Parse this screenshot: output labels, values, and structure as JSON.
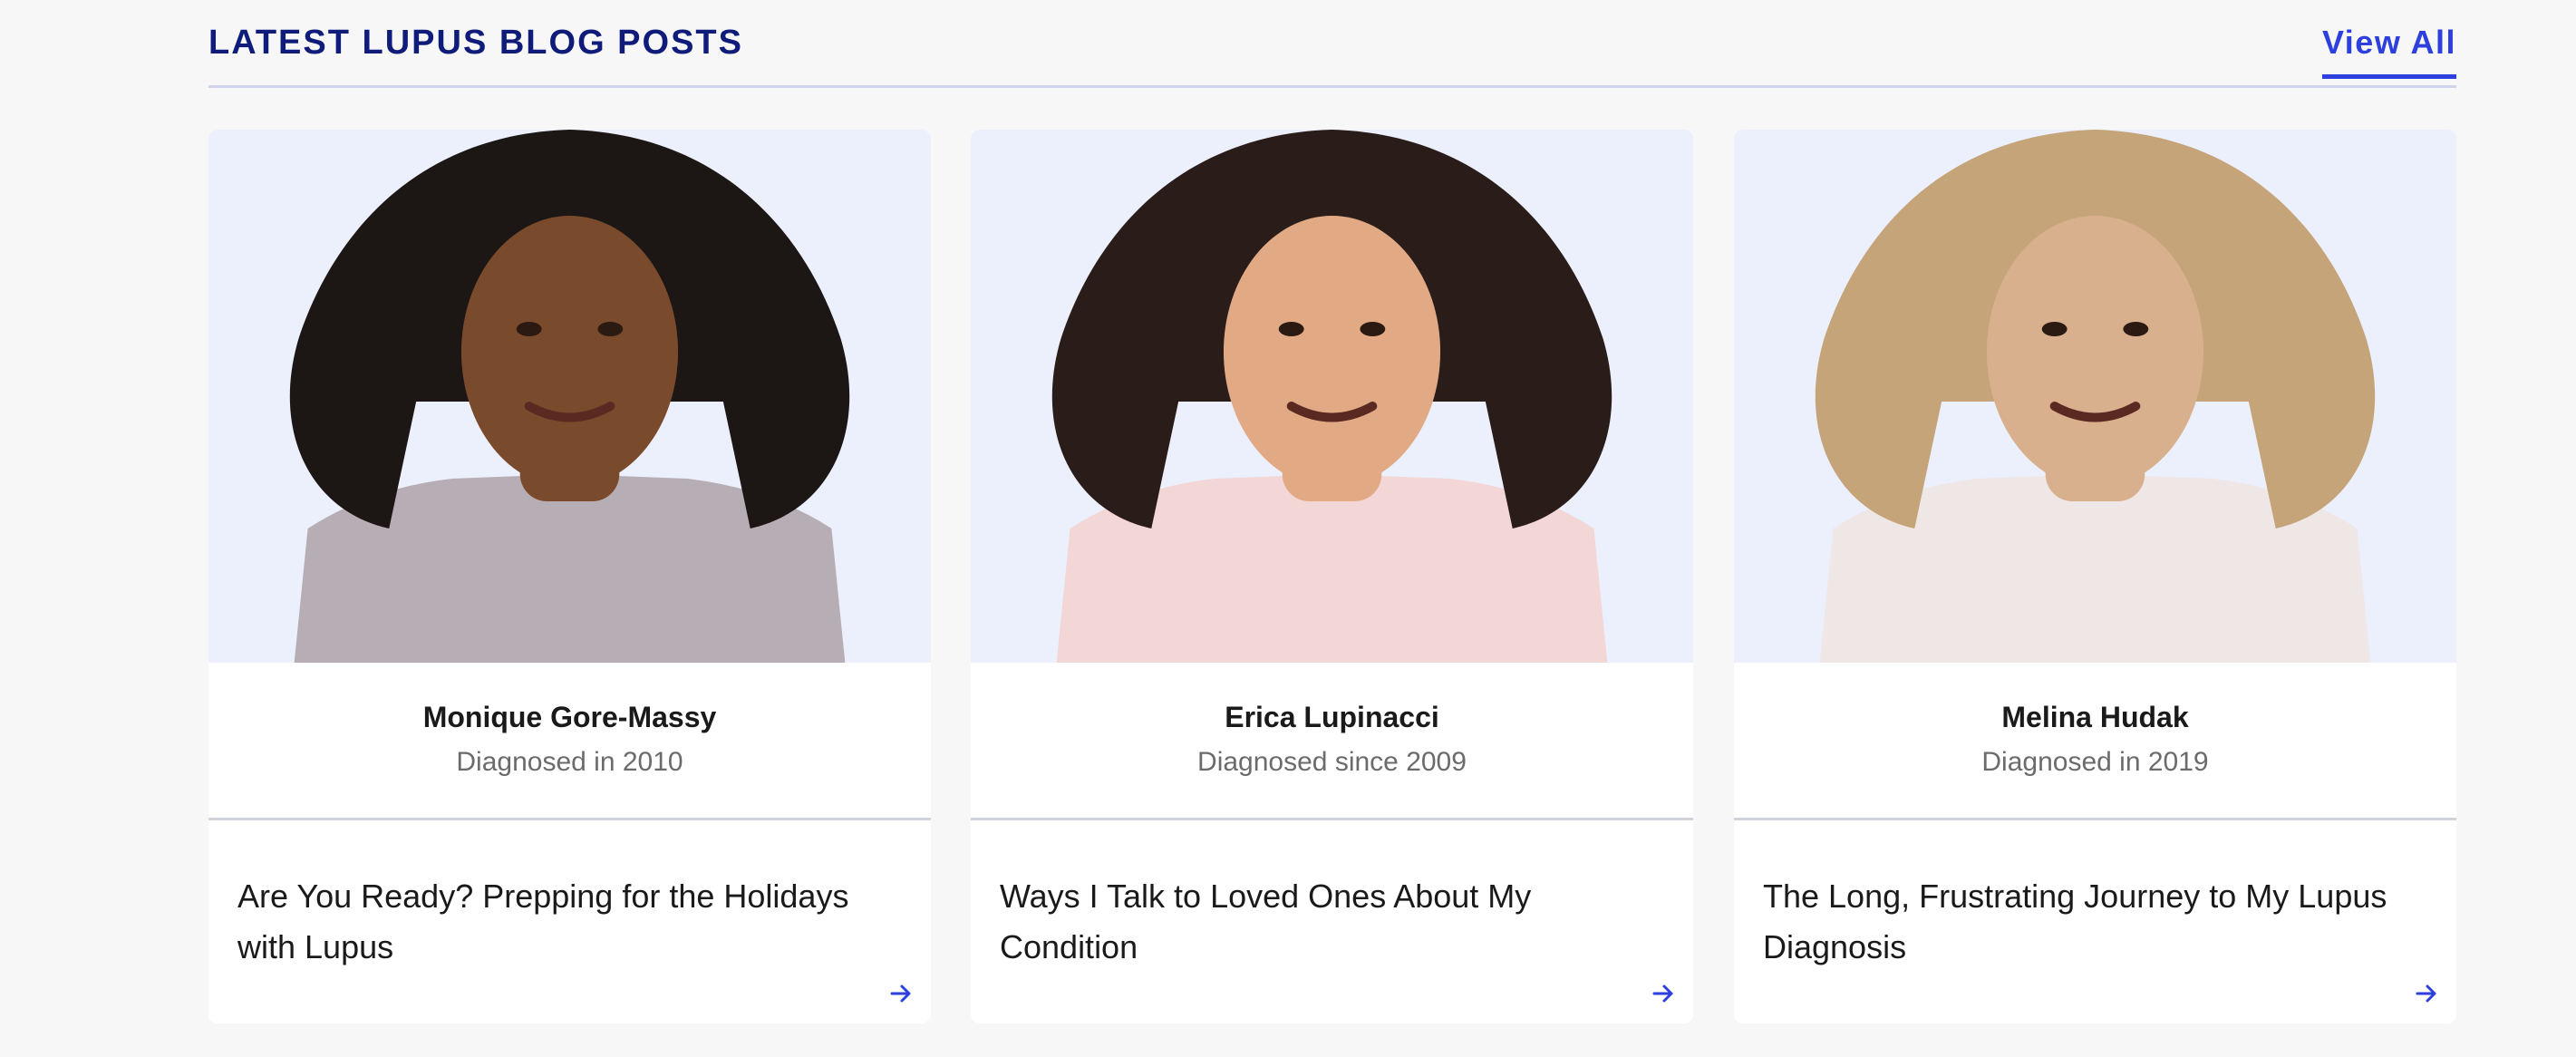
{
  "section": {
    "title": "LATEST LUPUS BLOG POSTS",
    "view_all_label": "View All"
  },
  "posts": [
    {
      "author": "Monique Gore-Massy",
      "diagnosis": "Diagnosed in 2010",
      "title": "Are You Ready? Prepping for the Holidays with Lupus",
      "portrait_icon": "portrait-illustration",
      "skin": "#7a4a2c",
      "hair": "#1c1614",
      "shirt": "#b6aeb4"
    },
    {
      "author": "Erica Lupinacci",
      "diagnosis": "Diagnosed since 2009",
      "title": "Ways I Talk to Loved Ones About My Condition",
      "portrait_icon": "portrait-illustration",
      "skin": "#e2aa84",
      "hair": "#2a1d19",
      "shirt": "#f3d6d6"
    },
    {
      "author": "Melina Hudak",
      "diagnosis": "Diagnosed in 2019",
      "title": "The Long, Frustrating Journey to My Lupus Diagnosis",
      "portrait_icon": "portrait-illustration",
      "skin": "#d9b08e",
      "hair": "#c4a478",
      "shirt": "#efe6e6"
    }
  ],
  "colors": {
    "accent": "#2d3fdc",
    "heading": "#101c7a",
    "portrait_bg": "#eceffc"
  },
  "arrow_icon": "arrow-right-icon"
}
